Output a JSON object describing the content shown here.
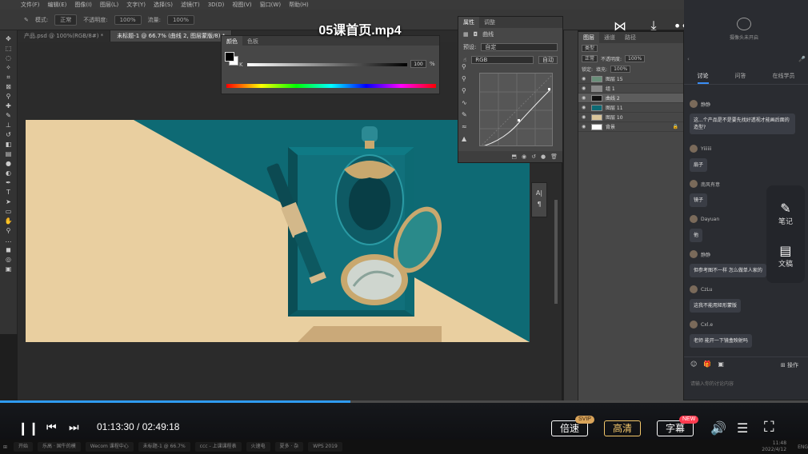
{
  "video": {
    "title": "05课首页.mp4",
    "current_time": "01:13:30",
    "total_time": "02:49:18",
    "time_display": "01:13:30 / 02:49:18",
    "progress_fraction": 0.434,
    "speed_label": "倍速",
    "speed_badge": "SVIP",
    "quality_label": "高清",
    "subtitle_label": "字幕",
    "subtitle_badge": "NEW",
    "colors": {
      "progress": "#2f9bf0",
      "quality": "#f4c86b",
      "svip": "#d9a45a",
      "new": "#ff3b4f"
    }
  },
  "ps": {
    "menu": [
      "文件(F)",
      "编辑(E)",
      "图像(I)",
      "图层(L)",
      "文字(Y)",
      "选择(S)",
      "滤镜(T)",
      "3D(D)",
      "视图(V)",
      "窗口(W)",
      "帮助(H)"
    ],
    "options": {
      "mode_label": "模式:",
      "mode_value": "正常",
      "opacity_label": "不透明度:",
      "opacity_value": "100%",
      "flow_label": "流量:",
      "flow_value": "100%"
    },
    "tabs": [
      "产品.psd @ 100%(RGB/8#) *",
      "未标题-1 @ 66.7% (曲线 2, 图层蒙版/8) *"
    ],
    "color_panel": {
      "tabs": [
        "颜色",
        "色板"
      ],
      "k_label": "K",
      "k_value": "100",
      "k_unit": "%"
    },
    "properties": {
      "tabs": [
        "属性",
        "调整"
      ],
      "title": "曲线",
      "preset_label": "预设:",
      "preset_value": "自定",
      "channel_value": "RGB",
      "auto_label": "自动"
    },
    "layers": {
      "tabs": [
        "图层",
        "通道",
        "路径"
      ],
      "kind_label": "类型",
      "blend_value": "正常",
      "opacity_label": "不透明度:",
      "opacity_value": "100%",
      "lock_label": "锁定:",
      "fill_label": "填充:",
      "fill_value": "100%",
      "items": [
        {
          "name": "图层 15",
          "color": "#6a8f7a"
        },
        {
          "name": "组 1",
          "color": "#888888"
        },
        {
          "name": "曲线 2",
          "color": "#111111"
        },
        {
          "name": "图层 11",
          "color": "#0e6a74"
        },
        {
          "name": "图层 10",
          "color": "#d9c49a"
        },
        {
          "name": "背景",
          "color": "#ffffff"
        }
      ]
    },
    "float_panel": [
      "A|",
      "¶"
    ]
  },
  "chat": {
    "camera_label": "摄像头未开启",
    "tabs": [
      "讨论",
      "问答",
      "在线学员"
    ],
    "messages": [
      {
        "user": "静静",
        "text": "这...个产品是不是要先找好透视才能画后面的造型?"
      },
      {
        "user": "Yiiiiii",
        "text": "扇子"
      },
      {
        "user": "南风有意",
        "text": "镜子"
      },
      {
        "user": "Dayuan",
        "text": "他"
      },
      {
        "user": "静静",
        "text": "但参考图不一样 怎么做单人家的"
      },
      {
        "user": "CzLu",
        "text": "这我不能用矩形蒙版"
      },
      {
        "user": "Cxl.e",
        "text": "老师 能开一下镜盒映射吗"
      }
    ],
    "side_tools": [
      "笔记",
      "文稿"
    ],
    "op_label": "操作",
    "input_placeholder": "请输入你的讨论内容"
  },
  "taskbar": {
    "apps": [
      "开始",
      "乐高 · 国牛的模",
      "Wecom 课程中心",
      "未标题-1 @ 66.7%",
      "ccc - 上课课程表",
      "火速电",
      "夏多 · 杂",
      "WPS 2019"
    ],
    "clock": "11:48",
    "date": "2022/4/12",
    "lang": "ENG"
  }
}
